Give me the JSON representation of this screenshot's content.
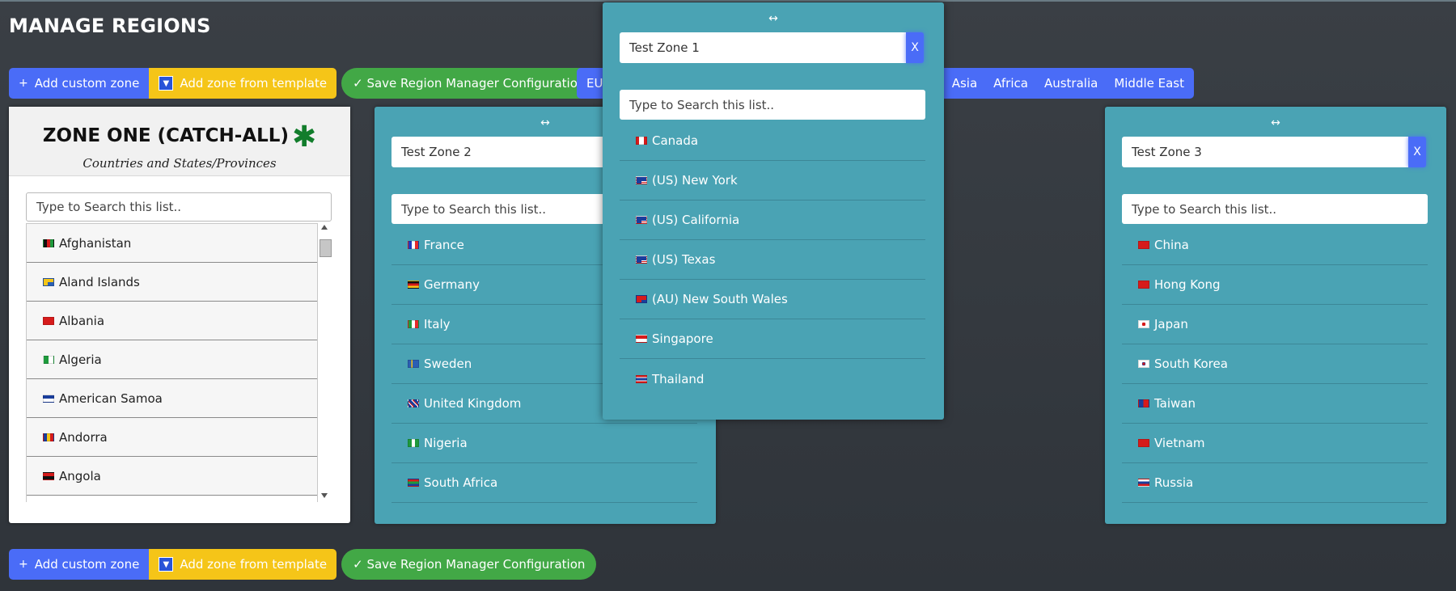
{
  "page": {
    "title": "MANAGE REGIONS"
  },
  "toolbar": {
    "add_custom_label": "Add custom zone",
    "add_template_label": "Add zone from template",
    "save_label": "✓ Save Region Manager Configuration"
  },
  "regions": [
    "EU",
    "Asia",
    "Africa",
    "Australia",
    "Middle East"
  ],
  "zone_one": {
    "title": "ZONE ONE (CATCH-ALL)",
    "star": "✱",
    "subtitle": "Countries and States/Provinces",
    "search_placeholder": "Type to Search this list..",
    "items": [
      "Afghanistan",
      "Aland Islands",
      "Albania",
      "Algeria",
      "American Samoa",
      "Andorra",
      "Angola"
    ]
  },
  "zone2": {
    "name": "Test Zone 2",
    "search_placeholder": "Type to Search this list..",
    "items": [
      "France",
      "Germany",
      "Italy",
      "Sweden",
      "United Kingdom",
      "Nigeria",
      "South Africa"
    ]
  },
  "zone1": {
    "name": "Test Zone 1",
    "close_label": "X",
    "search_placeholder": "Type to Search this list..",
    "items": [
      "Canada",
      "(US) New York",
      "(US) California",
      "(US) Texas",
      "(AU) New South Wales",
      "Singapore",
      "Thailand"
    ]
  },
  "zone3": {
    "name": "Test Zone 3",
    "close_label": "X",
    "search_placeholder": "Type to Search this list..",
    "items": [
      "China",
      "Hong Kong",
      "Japan",
      "South Korea",
      "Taiwan",
      "Vietnam",
      "Russia"
    ]
  },
  "drag_glyph": "↔",
  "colors": {
    "accent_blue": "#4a6cf7",
    "template_yellow": "#f5c518",
    "save_green": "#42a846",
    "zone_teal": "#4aa3b4"
  }
}
